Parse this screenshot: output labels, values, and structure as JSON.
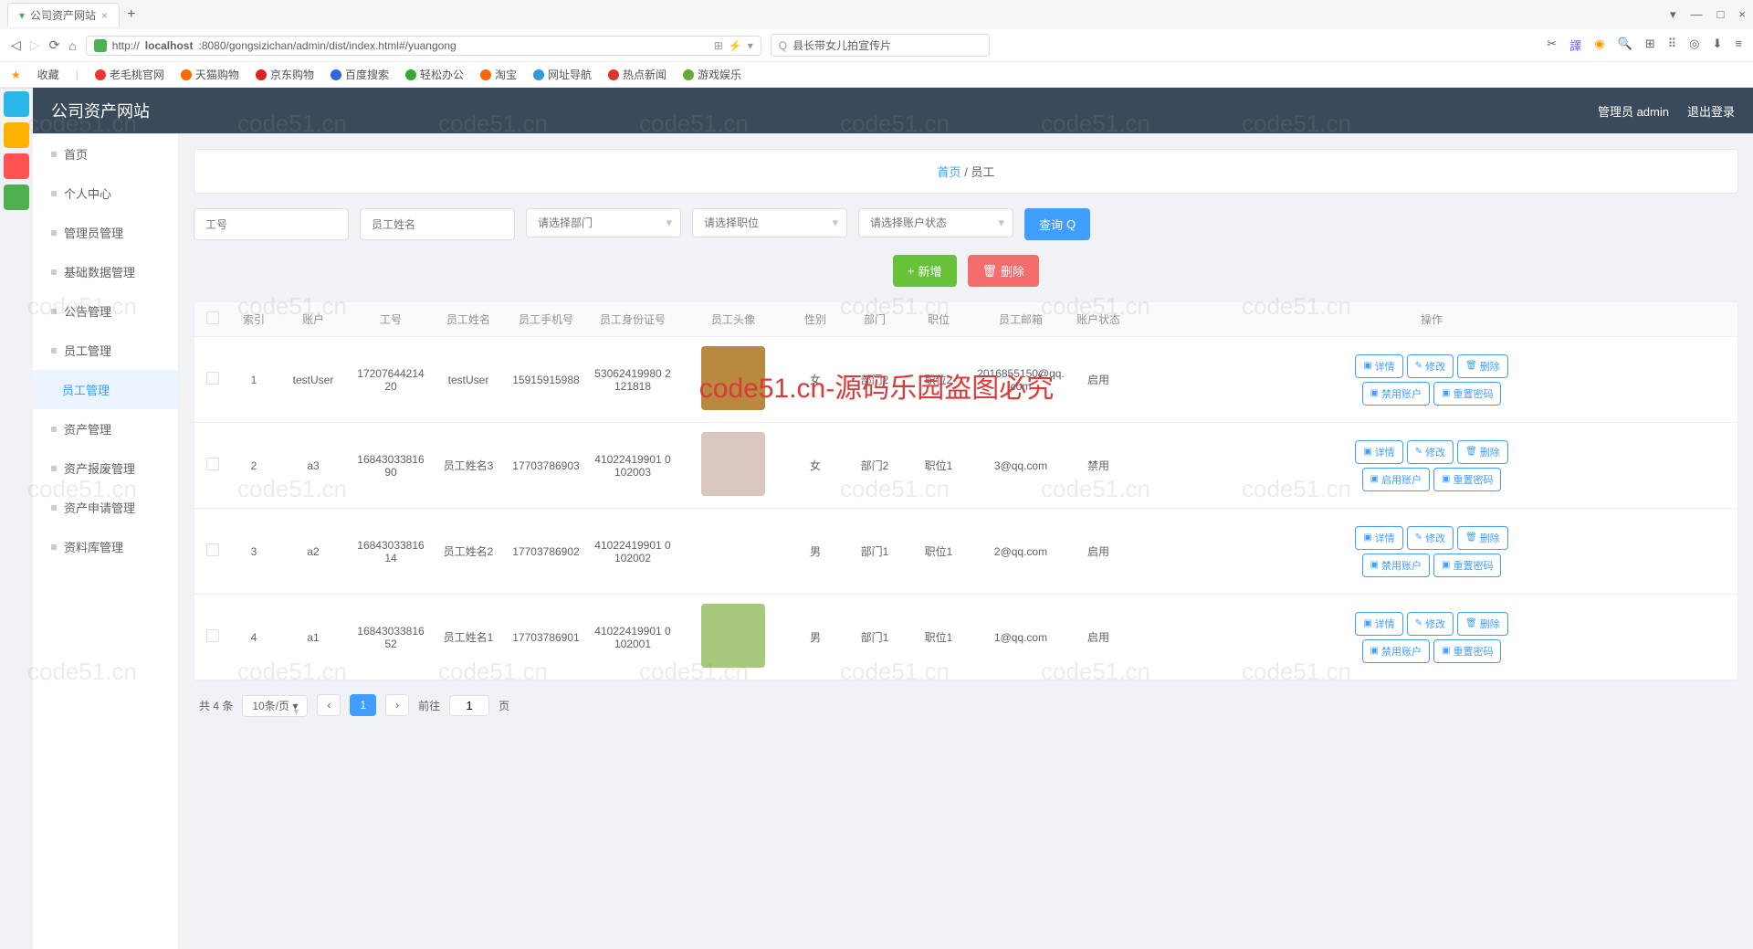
{
  "browser": {
    "tab_title": "公司资产网站",
    "url_prefix": "http://",
    "url_host": "localhost",
    "url_port_path": ":8080/gongsizichan/admin/dist/index.html#/yuangong",
    "search_value": "县长带女儿拍宣传片",
    "bookmarks_label": "收藏",
    "bookmarks": [
      "老毛桃官网",
      "天猫购物",
      "京东购物",
      "百度搜索",
      "轻松办公",
      "淘宝",
      "网址导航",
      "热点新闻",
      "游戏娱乐"
    ]
  },
  "win": {
    "min": "—",
    "max": "□",
    "close": "×",
    "menu": "▾"
  },
  "app": {
    "title": "公司资产网站",
    "admin_label": "管理员 admin",
    "logout": "退出登录"
  },
  "menu": {
    "items": [
      "首页",
      "个人中心",
      "管理员管理",
      "基础数据管理",
      "公告管理",
      "员工管理",
      "员工管理",
      "资产管理",
      "资产报废管理",
      "资产申请管理",
      "资料库管理"
    ],
    "active_index": 6
  },
  "bread": {
    "home": "首页",
    "sep": " / ",
    "current": "员工"
  },
  "filters": {
    "jobno_ph": "工号",
    "name_ph": "员工姓名",
    "dept_ph": "请选择部门",
    "pos_ph": "请选择职位",
    "status_ph": "请选择账户状态",
    "query": "查询"
  },
  "actions": {
    "add": "新增",
    "delete": "删除"
  },
  "table": {
    "headers": {
      "idx": "索引",
      "acc": "账户",
      "jobno": "工号",
      "name": "员工姓名",
      "phone": "员工手机号",
      "id": "员工身份证号",
      "avatar": "员工头像",
      "sex": "性别",
      "dept": "部门",
      "pos": "职位",
      "email": "员工邮箱",
      "status": "账户状态",
      "ops": "操作"
    },
    "rows": [
      {
        "idx": "1",
        "acc": "testUser",
        "jobno": "17207644214 20",
        "name": "testUser",
        "phone": "15915915988",
        "idc": "53062419980 2121818",
        "avatarColor": "#b8893e",
        "sex": "女",
        "dept": "部门2",
        "pos": "职位2",
        "email": "2016855150@qq.com",
        "status": "启用",
        "toggle": "禁用账户"
      },
      {
        "idx": "2",
        "acc": "a3",
        "jobno": "16843033816 90",
        "name": "员工姓名3",
        "phone": "17703786903",
        "idc": "41022419901 0102003",
        "avatarColor": "#d9c7c0",
        "sex": "女",
        "dept": "部门2",
        "pos": "职位1",
        "email": "3@qq.com",
        "status": "禁用",
        "toggle": "启用账户"
      },
      {
        "idx": "3",
        "acc": "a2",
        "jobno": "16843033816 14",
        "name": "员工姓名2",
        "phone": "17703786902",
        "idc": "41022419901 0102002",
        "avatarColor": "#fff",
        "sex": "男",
        "dept": "部门1",
        "pos": "职位1",
        "email": "2@qq.com",
        "status": "启用",
        "toggle": "禁用账户"
      },
      {
        "idx": "4",
        "acc": "a1",
        "jobno": "16843033816 52",
        "name": "员工姓名1",
        "phone": "17703786901",
        "idc": "41022419901 0102001",
        "avatarColor": "#a8c97b",
        "sex": "男",
        "dept": "部门1",
        "pos": "职位1",
        "email": "1@qq.com",
        "status": "启用",
        "toggle": "禁用账户"
      }
    ],
    "ops": {
      "detail": "详情",
      "edit": "修改",
      "del": "删除",
      "reset": "重置密码"
    }
  },
  "pager": {
    "total": "共 4 条",
    "per_page": "10条/页",
    "goto": "前往",
    "page": "1",
    "page_unit": "页"
  },
  "watermark": "code51.cn",
  "watermark_red": "code51.cn-源码乐园盗图必究"
}
